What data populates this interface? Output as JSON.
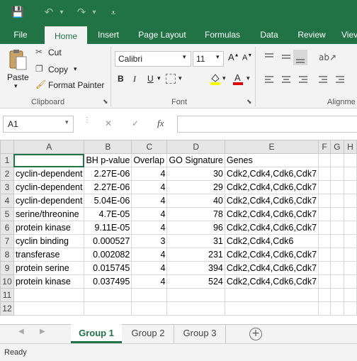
{
  "quick_access": {
    "save_icon": "💾",
    "undo_icon": "↶",
    "redo_icon": "↷",
    "dropdown_icon": "▾",
    "customize_icon": "⩡"
  },
  "tabs": [
    "File",
    "Home",
    "Insert",
    "Page Layout",
    "Formulas",
    "Data",
    "Review",
    "Viev"
  ],
  "clipboard": {
    "paste": "Paste",
    "cut": "Cut",
    "copy": "Copy",
    "format_painter": "Format Painter",
    "label": "Clipboard"
  },
  "font": {
    "name": "Calibri",
    "size": "11",
    "bold": "B",
    "italic": "I",
    "underline": "U",
    "label": "Font"
  },
  "alignment": {
    "label": "Alignme"
  },
  "formula_bar": {
    "name_box": "A1",
    "cancel": "✕",
    "enter": "✓",
    "fx": "fx",
    "value": ""
  },
  "columns": [
    "A",
    "B",
    "C",
    "D",
    "E",
    "F",
    "G",
    "H"
  ],
  "rows": [
    [
      "",
      "BH p-value",
      "Overlap",
      "GO Signature",
      "Genes",
      "",
      "",
      ""
    ],
    [
      "cyclin-dependent",
      "2.27E-06",
      "4",
      "30",
      "Cdk2,Cdk4,Cdk6,Cdk7",
      "",
      "",
      ""
    ],
    [
      "cyclin-dependent",
      "2.27E-06",
      "4",
      "29",
      "Cdk2,Cdk4,Cdk6,Cdk7",
      "",
      "",
      ""
    ],
    [
      "cyclin-dependent",
      "5.04E-06",
      "4",
      "40",
      "Cdk2,Cdk4,Cdk6,Cdk7",
      "",
      "",
      ""
    ],
    [
      "serine/threonine",
      "4.7E-05",
      "4",
      "78",
      "Cdk2,Cdk4,Cdk6,Cdk7",
      "",
      "",
      ""
    ],
    [
      "protein kinase",
      "9.11E-05",
      "4",
      "96",
      "Cdk2,Cdk4,Cdk6,Cdk7",
      "",
      "",
      ""
    ],
    [
      "cyclin binding",
      "0.000527",
      "3",
      "31",
      "Cdk2,Cdk4,Cdk6",
      "",
      "",
      ""
    ],
    [
      "transferase",
      "0.002082",
      "4",
      "231",
      "Cdk2,Cdk4,Cdk6,Cdk7",
      "",
      "",
      ""
    ],
    [
      "protein serine",
      "0.015745",
      "4",
      "394",
      "Cdk2,Cdk4,Cdk6,Cdk7",
      "",
      "",
      ""
    ],
    [
      "protein kinase",
      "0.037495",
      "4",
      "524",
      "Cdk2,Cdk4,Cdk6,Cdk7",
      "",
      "",
      ""
    ],
    [
      "",
      "",
      "",
      "",
      "",
      "",
      "",
      ""
    ],
    [
      "",
      "",
      "",
      "",
      "",
      "",
      "",
      ""
    ]
  ],
  "row_numbers": [
    "1",
    "2",
    "3",
    "4",
    "5",
    "6",
    "7",
    "8",
    "9",
    "10",
    "11",
    "12"
  ],
  "sheets": [
    "Group 1",
    "Group 2",
    "Group 3"
  ],
  "status": "Ready",
  "colors": {
    "accent": "#217346"
  }
}
